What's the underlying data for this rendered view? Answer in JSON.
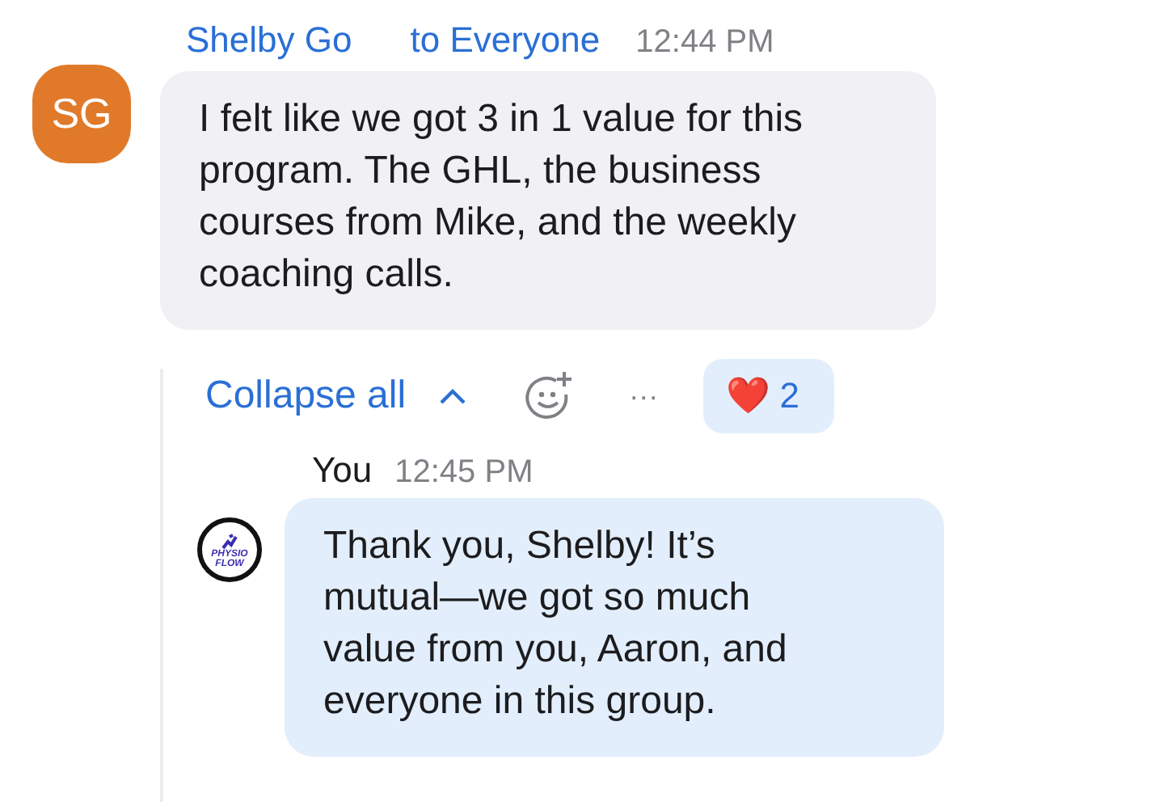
{
  "message": {
    "avatar_initials": "SG",
    "sender": "Shelby Go",
    "audience": "to Everyone",
    "time": "12:44 PM",
    "text": "I felt like we got 3 in 1 value for this program. The GHL, the business courses from Mike, and the weekly coaching calls."
  },
  "thread": {
    "collapse_label": "Collapse all",
    "reaction": {
      "emoji": "❤️",
      "count": "2",
      "selected": true
    },
    "more_label": "···"
  },
  "reply": {
    "sender": "You",
    "time": "12:45 PM",
    "logo_text": [
      "PHYSIO",
      "FLOW"
    ],
    "text": "Thank you, Shelby! It’s mutual—we got so much value from you, Aaron, and everyone in this group."
  }
}
